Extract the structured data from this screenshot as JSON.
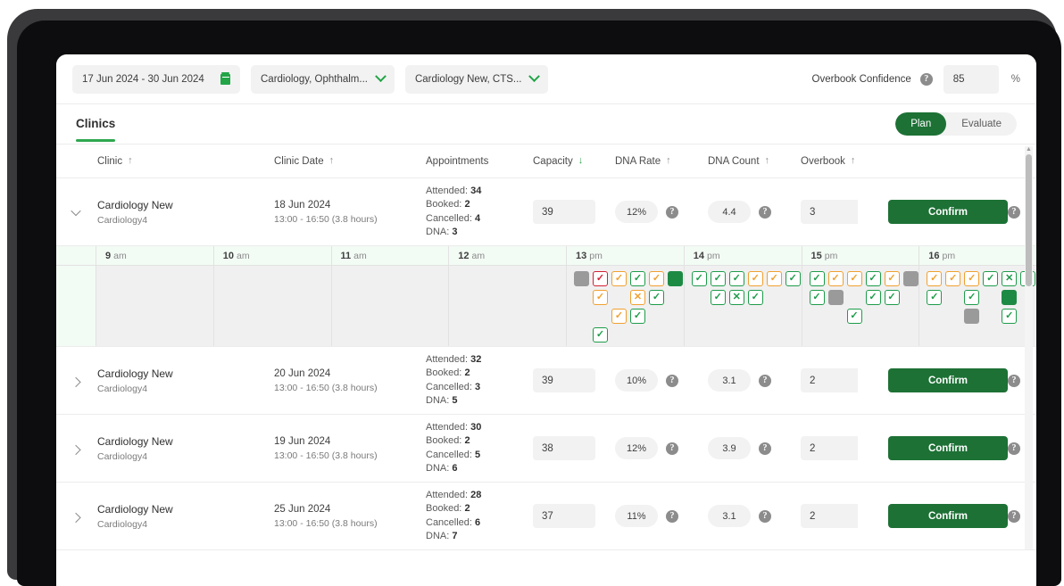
{
  "filters": {
    "date_range": "17 Jun 2024 - 30 Jun 2024",
    "calendar_icon": "calendar-icon",
    "specialty_select": "Cardiology, Ophthalm...",
    "clinic_select": "Cardiology New, CTS...",
    "chevron_icon": "chevron-down-icon"
  },
  "overbook_confidence": {
    "label": "Overbook Confidence",
    "help_icon": "help-icon",
    "value": "85",
    "unit": "%"
  },
  "panel": {
    "title": "Clinics",
    "toggle": {
      "plan": "Plan",
      "evaluate": "Evaluate",
      "active": "Plan"
    }
  },
  "columns": [
    {
      "label": "Clinic",
      "sort": "↑",
      "active": false
    },
    {
      "label": "Clinic Date",
      "sort": "↑",
      "active": false
    },
    {
      "label": "Appointments",
      "sort": "",
      "active": false
    },
    {
      "label": "Capacity",
      "sort": "↓",
      "active": true
    },
    {
      "label": "DNA Rate",
      "sort": "↑",
      "active": false
    },
    {
      "label": "DNA Count",
      "sort": "↑",
      "active": false
    },
    {
      "label": "Overbook",
      "sort": "↑",
      "active": false
    }
  ],
  "stat_labels": {
    "attended": "Attended:",
    "booked": "Booked:",
    "cancelled": "Cancelled:",
    "dna": "DNA:"
  },
  "confirm_label": "Confirm",
  "rows": [
    {
      "expanded": true,
      "clinic": "Cardiology New",
      "sub": "Cardiology4",
      "date": "18 Jun 2024",
      "time": "13:00 - 16:50 (3.8 hours)",
      "attended": "34",
      "booked": "2",
      "cancelled": "4",
      "dna": "3",
      "capacity": "39",
      "dna_rate": "12%",
      "dna_count": "4.4",
      "overbook": "3"
    },
    {
      "expanded": false,
      "clinic": "Cardiology New",
      "sub": "Cardiology4",
      "date": "20 Jun 2024",
      "time": "13:00 - 16:50 (3.8 hours)",
      "attended": "32",
      "booked": "2",
      "cancelled": "3",
      "dna": "5",
      "capacity": "39",
      "dna_rate": "10%",
      "dna_count": "3.1",
      "overbook": "2"
    },
    {
      "expanded": false,
      "clinic": "Cardiology New",
      "sub": "Cardiology4",
      "date": "19 Jun 2024",
      "time": "13:00 - 16:50 (3.8 hours)",
      "attended": "30",
      "booked": "2",
      "cancelled": "5",
      "dna": "6",
      "capacity": "38",
      "dna_rate": "12%",
      "dna_count": "3.9",
      "overbook": "2"
    },
    {
      "expanded": false,
      "clinic": "Cardiology New",
      "sub": "Cardiology4",
      "date": "25 Jun 2024",
      "time": "13:00 - 16:50 (3.8 hours)",
      "attended": "28",
      "booked": "2",
      "cancelled": "6",
      "dna": "7",
      "capacity": "37",
      "dna_rate": "11%",
      "dna_count": "3.1",
      "overbook": "2"
    }
  ],
  "timeline": {
    "slots": [
      {
        "hour": "9",
        "period": "am"
      },
      {
        "hour": "10",
        "period": "am"
      },
      {
        "hour": "11",
        "period": "am"
      },
      {
        "hour": "12",
        "period": "am"
      },
      {
        "hour": "13",
        "period": "pm"
      },
      {
        "hour": "14",
        "period": "pm"
      },
      {
        "hour": "15",
        "period": "pm"
      },
      {
        "hour": "16",
        "period": "pm"
      }
    ],
    "appointments": [
      [],
      [],
      [],
      [],
      [
        {
          "style": "filled-gray",
          "mark": ""
        },
        {
          "style": "red",
          "mark": "✓"
        },
        {
          "style": "orange",
          "mark": "✓"
        },
        {
          "style": "green",
          "mark": "✓"
        },
        {
          "style": "orange",
          "mark": "✓"
        },
        {
          "style": "filled-green",
          "mark": ""
        },
        {
          "style": "blank",
          "mark": ""
        },
        {
          "style": "orange",
          "mark": "✓"
        },
        {
          "style": "blank",
          "mark": ""
        },
        {
          "style": "orange",
          "mark": "✕"
        },
        {
          "style": "green",
          "mark": "✓"
        },
        {
          "style": "blank",
          "mark": ""
        },
        {
          "style": "blank",
          "mark": ""
        },
        {
          "style": "blank",
          "mark": ""
        },
        {
          "style": "orange",
          "mark": "✓"
        },
        {
          "style": "green",
          "mark": "✓"
        },
        {
          "style": "blank",
          "mark": ""
        },
        {
          "style": "blank",
          "mark": ""
        },
        {
          "style": "blank",
          "mark": ""
        },
        {
          "style": "green",
          "mark": "✓"
        }
      ],
      [
        {
          "style": "green",
          "mark": "✓"
        },
        {
          "style": "green",
          "mark": "✓"
        },
        {
          "style": "green",
          "mark": "✓"
        },
        {
          "style": "orange",
          "mark": "✓"
        },
        {
          "style": "orange",
          "mark": "✓"
        },
        {
          "style": "green",
          "mark": "✓"
        },
        {
          "style": "blank",
          "mark": ""
        },
        {
          "style": "green",
          "mark": "✓"
        },
        {
          "style": "green",
          "mark": "✕"
        },
        {
          "style": "green",
          "mark": "✓"
        }
      ],
      [
        {
          "style": "green",
          "mark": "✓"
        },
        {
          "style": "orange",
          "mark": "✓"
        },
        {
          "style": "orange",
          "mark": "✓"
        },
        {
          "style": "green",
          "mark": "✓"
        },
        {
          "style": "orange",
          "mark": "✓"
        },
        {
          "style": "filled-gray",
          "mark": ""
        },
        {
          "style": "green",
          "mark": "✓"
        },
        {
          "style": "filled-gray",
          "mark": ""
        },
        {
          "style": "blank",
          "mark": ""
        },
        {
          "style": "green",
          "mark": "✓"
        },
        {
          "style": "green",
          "mark": "✓"
        },
        {
          "style": "blank",
          "mark": ""
        },
        {
          "style": "blank",
          "mark": ""
        },
        {
          "style": "blank",
          "mark": ""
        },
        {
          "style": "green",
          "mark": "✓"
        }
      ],
      [
        {
          "style": "orange",
          "mark": "✓"
        },
        {
          "style": "orange",
          "mark": "✓"
        },
        {
          "style": "orange",
          "mark": "✓"
        },
        {
          "style": "green",
          "mark": "✓"
        },
        {
          "style": "green",
          "mark": "✕"
        },
        {
          "style": "green",
          "mark": "✓"
        },
        {
          "style": "green",
          "mark": "✓"
        },
        {
          "style": "blank",
          "mark": ""
        },
        {
          "style": "green",
          "mark": "✓"
        },
        {
          "style": "blank",
          "mark": ""
        },
        {
          "style": "filled-green",
          "mark": ""
        },
        {
          "style": "blank",
          "mark": ""
        },
        {
          "style": "blank",
          "mark": ""
        },
        {
          "style": "blank",
          "mark": ""
        },
        {
          "style": "filled-gray",
          "mark": ""
        },
        {
          "style": "blank",
          "mark": ""
        },
        {
          "style": "green",
          "mark": "✓"
        }
      ]
    ]
  }
}
